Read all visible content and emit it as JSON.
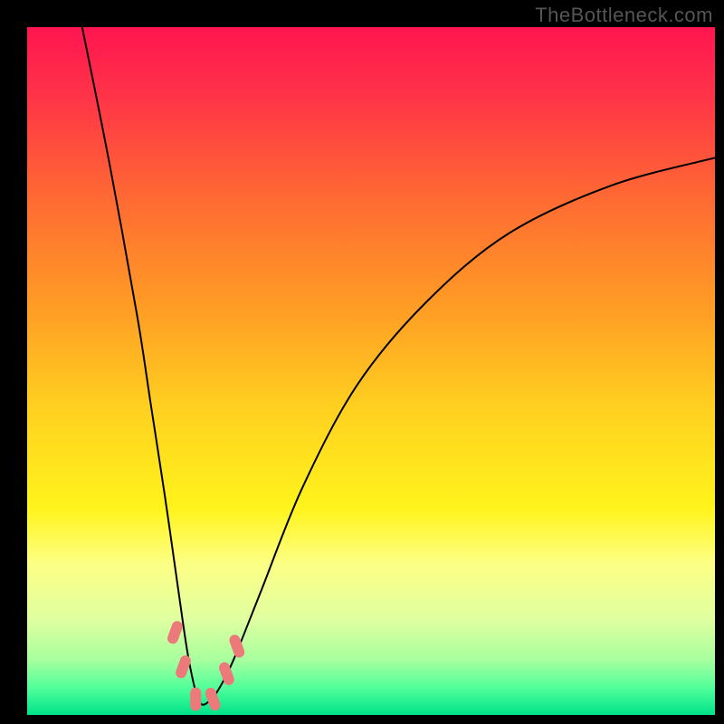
{
  "watermark": "TheBottleneck.com",
  "chart_data": {
    "type": "line",
    "title": "",
    "xlabel": "",
    "ylabel": "",
    "xlim": [
      0,
      100
    ],
    "ylim": [
      0,
      100
    ],
    "background_gradient_stops": [
      {
        "offset": 0.0,
        "color": "#ff1550"
      },
      {
        "offset": 0.1,
        "color": "#ff3348"
      },
      {
        "offset": 0.25,
        "color": "#ff6a33"
      },
      {
        "offset": 0.4,
        "color": "#ff9a25"
      },
      {
        "offset": 0.55,
        "color": "#ffcf20"
      },
      {
        "offset": 0.7,
        "color": "#fff41c"
      },
      {
        "offset": 0.78,
        "color": "#fdff85"
      },
      {
        "offset": 0.86,
        "color": "#e0ffa0"
      },
      {
        "offset": 0.92,
        "color": "#a8ff9e"
      },
      {
        "offset": 0.96,
        "color": "#52ff9a"
      },
      {
        "offset": 1.0,
        "color": "#00e28a"
      }
    ],
    "series": [
      {
        "name": "bottleneck-curve",
        "x": [
          8,
          12,
          16,
          18,
          20,
          22,
          23.5,
          25,
          26.5,
          28,
          30,
          34,
          40,
          48,
          58,
          70,
          85,
          100
        ],
        "y": [
          100,
          80,
          58,
          45,
          32,
          18,
          8,
          2,
          2,
          4,
          8,
          18,
          33,
          48,
          60,
          70,
          77,
          81
        ]
      }
    ],
    "markers": {
      "name": "curve-markers",
      "points": [
        {
          "x": 21.5,
          "y": 12
        },
        {
          "x": 22.7,
          "y": 7
        },
        {
          "x": 24.5,
          "y": 2.3
        },
        {
          "x": 27.0,
          "y": 2.3
        },
        {
          "x": 29.0,
          "y": 6
        },
        {
          "x": 30.5,
          "y": 10
        }
      ]
    }
  }
}
